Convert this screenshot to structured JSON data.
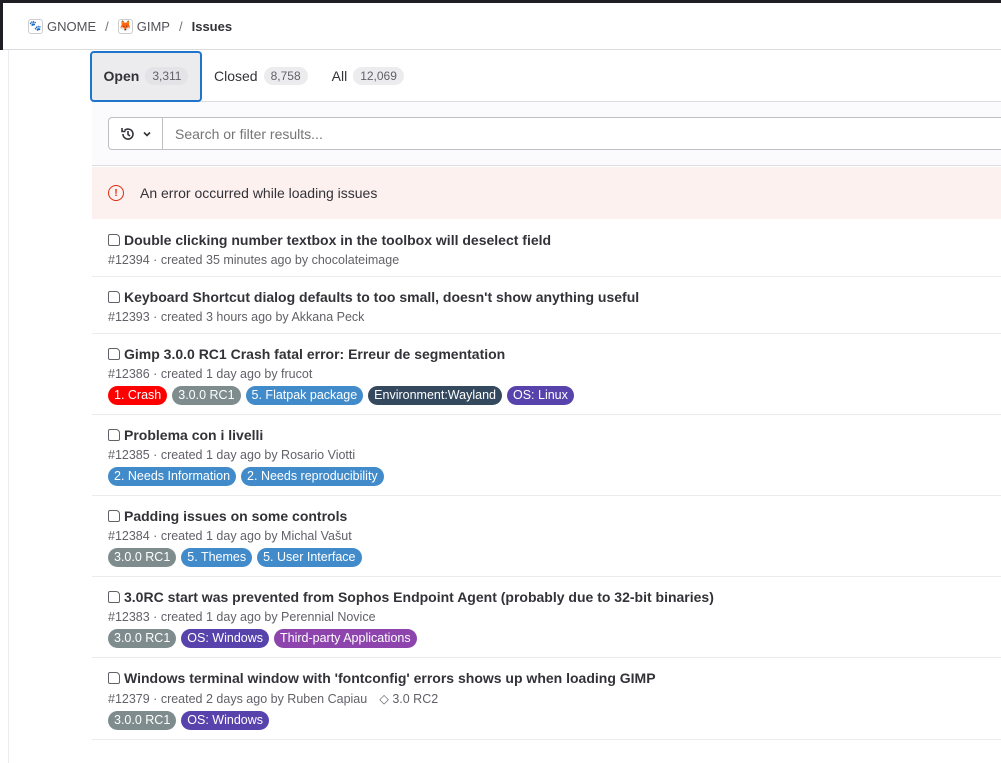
{
  "breadcrumb": [
    {
      "label": "GNOME",
      "icon": "gnome-foot-icon"
    },
    {
      "label": "GIMP",
      "icon": "gimp-icon"
    },
    {
      "label": "Issues"
    }
  ],
  "tabs": [
    {
      "label": "Open",
      "count": "3,311"
    },
    {
      "label": "Closed",
      "count": "8,758"
    },
    {
      "label": "All",
      "count": "12,069"
    }
  ],
  "search": {
    "placeholder": "Search or filter results..."
  },
  "alert": {
    "message": "An error occurred while loading issues"
  },
  "issues": [
    {
      "title": "Double clicking number textbox in the toolbox will deselect field",
      "meta": "#12394 · created 35 minutes ago by chocolateimage",
      "labels": []
    },
    {
      "title": "Keyboard Shortcut dialog defaults to too small, doesn't show anything useful",
      "meta": "#12393 · created 3 hours ago by Akkana Peck",
      "labels": []
    },
    {
      "title": "Gimp 3.0.0 RC1 Crash fatal error: Erreur de segmentation",
      "meta": "#12386 · created 1 day ago by frucot",
      "labels": [
        {
          "text": "1. Crash",
          "color": "#ff0000"
        },
        {
          "text": "3.0.0 RC1",
          "color": "#7f8c8d"
        },
        {
          "text": "5. Flatpak package",
          "color": "#428bca"
        },
        {
          "text": "Environment:Wayland",
          "color": "#34495e"
        },
        {
          "text": "OS: Linux",
          "color": "#5843ad"
        }
      ]
    },
    {
      "title": "Problema con i livelli",
      "meta": "#12385 · created 1 day ago by Rosario Viotti",
      "labels": [
        {
          "text": "2. Needs Information",
          "color": "#428bca"
        },
        {
          "text": "2. Needs reproducibility",
          "color": "#428bca"
        }
      ]
    },
    {
      "title": "Padding issues on some controls",
      "meta": "#12384 · created 1 day ago by Michal Vašut",
      "labels": [
        {
          "text": "3.0.0 RC1",
          "color": "#7f8c8d"
        },
        {
          "text": "5. Themes",
          "color": "#428bca"
        },
        {
          "text": "5. User Interface",
          "color": "#428bca"
        }
      ]
    },
    {
      "title": "3.0RC start was prevented from Sophos Endpoint Agent (probably due to 32-bit binaries)",
      "meta": "#12383 · created 1 day ago by Perennial Novice",
      "labels": [
        {
          "text": "3.0.0 RC1",
          "color": "#7f8c8d"
        },
        {
          "text": "OS: Windows",
          "color": "#5843ad"
        },
        {
          "text": "Third-party Applications",
          "color": "#8e44ad"
        }
      ]
    },
    {
      "title": "Windows terminal window with 'fontconfig' errors shows up when loading GIMP",
      "meta": "#12379 · created 2 days ago by Ruben Capiau",
      "milestone": "3.0 RC2",
      "labels": [
        {
          "text": "3.0.0 RC1",
          "color": "#7f8c8d"
        },
        {
          "text": "OS: Windows",
          "color": "#5843ad"
        }
      ]
    }
  ]
}
